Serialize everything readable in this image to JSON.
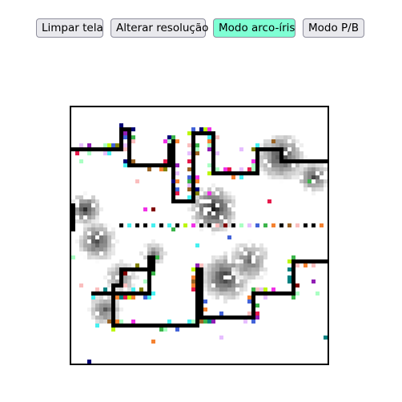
{
  "toolbar": {
    "clear_label": "Limpar tela",
    "resolution_label": "Alterar resolução",
    "rainbow_label": "Modo arco-íris",
    "bw_label": "Modo P/B",
    "active_mode": "rainbow",
    "active_color": "#7fffd4"
  },
  "canvas": {
    "description_mode": "pixel-grid drawing",
    "colors": {
      "background": "#ffffff",
      "ink": "#000000",
      "rainbow": [
        "#e6194b",
        "#3cb44b",
        "#4363d8",
        "#f58231",
        "#911eb4",
        "#46f0f0",
        "#f032e6",
        "#bcf60c",
        "#fabebe",
        "#008080",
        "#e6beff",
        "#9a6324",
        "#800000",
        "#aaffc3",
        "#808000",
        "#000075"
      ]
    }
  }
}
